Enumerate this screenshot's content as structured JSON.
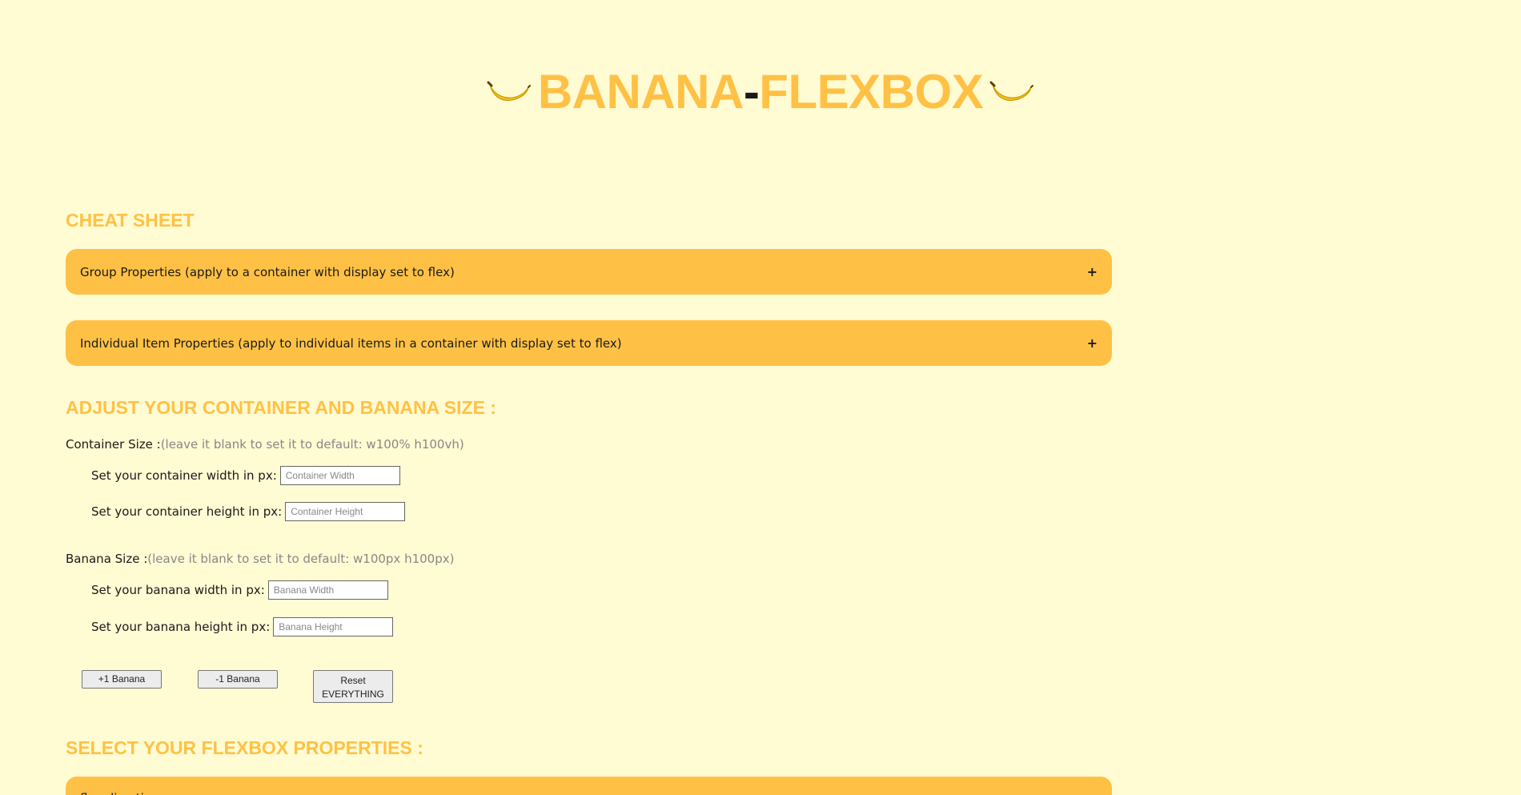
{
  "header": {
    "title_part1": "BANANA",
    "title_dash": "-",
    "title_part2": "FLEXBOX",
    "brand_color": "#ffc145",
    "left_icon": "banana-icon",
    "right_icon": "banana-icon"
  },
  "cheat_sheet": {
    "heading": "CHEAT SHEET",
    "group_properties": {
      "label": "Group Properties (apply to a container with display set to flex)",
      "toggle": "+"
    },
    "item_properties": {
      "label": "Individual Item Properties (apply to individual items in a container with display set to flex)",
      "toggle": "+"
    }
  },
  "adjust": {
    "heading": "ADJUST YOUR CONTAINER AND BANANA SIZE :",
    "container": {
      "label": "Container Size :",
      "hint": "(leave it blank to set it to default: w100% h100vh)",
      "width_label": "Set your container width in px:",
      "width_placeholder": "Container Width",
      "height_label": "Set your container height in px:",
      "height_placeholder": "Container Height"
    },
    "banana": {
      "label": "Banana Size :",
      "hint": "(leave it blank to set it to default: w100px h100px)",
      "width_label": "Set your banana width in px:",
      "width_placeholder": "Banana Width",
      "height_label": "Set your banana height in px:",
      "height_placeholder": "Banana Height"
    },
    "buttons": {
      "add": "+1 Banana",
      "remove": "-1 Banana",
      "reset_line1": "Reset",
      "reset_line2": "EVERYTHING"
    }
  },
  "select": {
    "heading": "SELECT YOUR FLEXBOX PROPERTIES :",
    "first_panel_label": "flex-direction"
  }
}
